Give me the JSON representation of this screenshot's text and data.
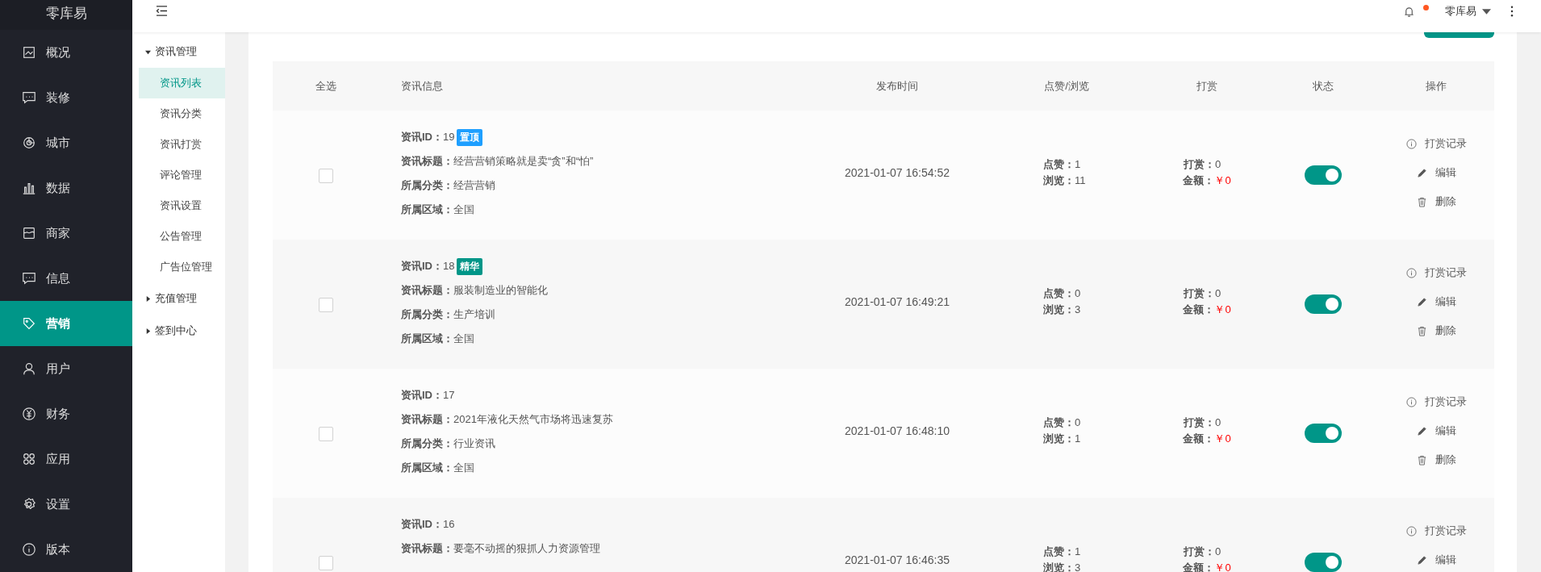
{
  "app": {
    "name": "零库易"
  },
  "topbar": {
    "notification_dot": true,
    "user": "零库易"
  },
  "nav": [
    {
      "label": "概况",
      "selected": false
    },
    {
      "label": "装修",
      "selected": false
    },
    {
      "label": "城市",
      "selected": false
    },
    {
      "label": "数据",
      "selected": false
    },
    {
      "label": "商家",
      "selected": false
    },
    {
      "label": "信息",
      "selected": false
    },
    {
      "label": "营销",
      "selected": true
    },
    {
      "label": "用户",
      "selected": false
    },
    {
      "label": "财务",
      "selected": false
    },
    {
      "label": "应用",
      "selected": false
    },
    {
      "label": "设置",
      "selected": false
    },
    {
      "label": "版本",
      "selected": false
    }
  ],
  "subnav": [
    {
      "label": "资讯管理",
      "expanded": true,
      "children": [
        {
          "label": "资讯列表",
          "selected": true
        },
        {
          "label": "资讯分类",
          "selected": false
        },
        {
          "label": "资讯打赏",
          "selected": false
        },
        {
          "label": "评论管理",
          "selected": false
        },
        {
          "label": "资讯设置",
          "selected": false
        },
        {
          "label": "公告管理",
          "selected": false
        },
        {
          "label": "广告位管理",
          "selected": false
        }
      ]
    },
    {
      "label": "充值管理",
      "expanded": false
    },
    {
      "label": "签到中心",
      "expanded": false
    }
  ],
  "table": {
    "columns": [
      "全选",
      "资讯信息",
      "发布时间",
      "点赞/浏览",
      "打赏",
      "状态",
      "操作"
    ],
    "rows": [
      {
        "checked": false,
        "fields": [
          {
            "label": "资讯ID：",
            "value": "19",
            "tag": {
              "text": "置顶",
              "color": "#1e9fff"
            }
          },
          {
            "label": "资讯标题：",
            "value": "经营营销策略就是卖“贪”和“怕”"
          },
          {
            "label": "所属分类：",
            "value": "经营营销"
          },
          {
            "label": "所属区域：",
            "value": "全国"
          }
        ],
        "time": "2021-01-07 16:54:52",
        "stats": [
          {
            "label": "点赞：",
            "value": "1"
          },
          {
            "label": "浏览：",
            "value": "11"
          }
        ],
        "rewards": [
          {
            "label": "打赏：",
            "value": "0",
            "kind": "plain"
          },
          {
            "label": "金额：",
            "value": "￥0",
            "kind": "money"
          }
        ],
        "enabled": true,
        "actions": [
          {
            "label": "打赏记录",
            "kind": "record"
          },
          {
            "label": "编辑",
            "kind": "edit"
          },
          {
            "label": "删除",
            "kind": "delete"
          }
        ]
      },
      {
        "checked": false,
        "fields": [
          {
            "label": "资讯ID：",
            "value": "18",
            "tag": {
              "text": "精华",
              "color": "#009688"
            }
          },
          {
            "label": "资讯标题：",
            "value": "服装制造业的智能化"
          },
          {
            "label": "所属分类：",
            "value": "生产培训"
          },
          {
            "label": "所属区域：",
            "value": "全国"
          }
        ],
        "time": "2021-01-07 16:49:21",
        "stats": [
          {
            "label": "点赞：",
            "value": "0"
          },
          {
            "label": "浏览：",
            "value": "3"
          }
        ],
        "rewards": [
          {
            "label": "打赏：",
            "value": "0",
            "kind": "plain"
          },
          {
            "label": "金额：",
            "value": "￥0",
            "kind": "money"
          }
        ],
        "enabled": true,
        "actions": [
          {
            "label": "打赏记录",
            "kind": "record"
          },
          {
            "label": "编辑",
            "kind": "edit"
          },
          {
            "label": "删除",
            "kind": "delete"
          }
        ]
      },
      {
        "checked": false,
        "fields": [
          {
            "label": "资讯ID：",
            "value": "17"
          },
          {
            "label": "资讯标题：",
            "value": "2021年液化天然气市场将迅速复苏"
          },
          {
            "label": "所属分类：",
            "value": "行业资讯"
          },
          {
            "label": "所属区域：",
            "value": "全国"
          }
        ],
        "time": "2021-01-07 16:48:10",
        "stats": [
          {
            "label": "点赞：",
            "value": "0"
          },
          {
            "label": "浏览：",
            "value": "1"
          }
        ],
        "rewards": [
          {
            "label": "打赏：",
            "value": "0",
            "kind": "plain"
          },
          {
            "label": "金额：",
            "value": "￥0",
            "kind": "money"
          }
        ],
        "enabled": true,
        "actions": [
          {
            "label": "打赏记录",
            "kind": "record"
          },
          {
            "label": "编辑",
            "kind": "edit"
          },
          {
            "label": "删除",
            "kind": "delete"
          }
        ]
      },
      {
        "checked": false,
        "fields": [
          {
            "label": "资讯ID：",
            "value": "16"
          },
          {
            "label": "资讯标题：",
            "value": "要毫不动摇的狠抓人力资源管理"
          }
        ],
        "time": "2021-01-07 16:46:35",
        "stats": [
          {
            "label": "点赞：",
            "value": "1"
          },
          {
            "label": "浏览：",
            "value": "3"
          }
        ],
        "rewards": [
          {
            "label": "打赏：",
            "value": "0",
            "kind": "plain"
          },
          {
            "label": "金额：",
            "value": "￥0",
            "kind": "money"
          }
        ],
        "enabled": true,
        "actions": [
          {
            "label": "打赏记录",
            "kind": "record"
          },
          {
            "label": "编辑",
            "kind": "edit"
          }
        ]
      }
    ]
  }
}
